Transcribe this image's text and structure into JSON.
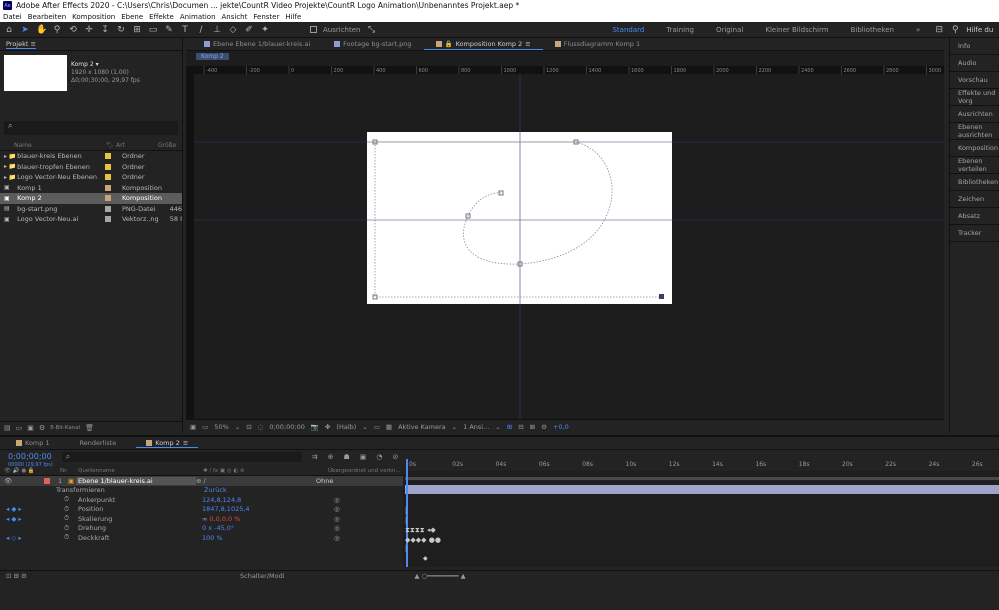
{
  "window": {
    "title": "Adobe After Effects 2020 - C:\\Users\\Chris\\Documen ... jekte\\CountR Video Projekte\\CountR Logo Animation\\Unbenanntes Projekt.aep *",
    "app_badge": "Ae"
  },
  "menu": [
    "Datei",
    "Bearbeiten",
    "Komposition",
    "Ebene",
    "Effekte",
    "Animation",
    "Ansicht",
    "Fenster",
    "Hilfe"
  ],
  "toolbar": {
    "align_label": "Ausrichten",
    "workspaces": [
      "Standard",
      "Training",
      "Original",
      "Kleiner Bildschirm",
      "Bibliotheken"
    ],
    "active_workspace": "Standard",
    "more": "»",
    "search_help": "Hilfe du"
  },
  "project": {
    "tab": "Projekt",
    "preview": {
      "name": "Komp 2 ▾",
      "size": "1920 x 1080 (1,00)",
      "duration": "Δ0;00;30;00, 29,97 fps"
    },
    "search_icon": "⌕",
    "columns": {
      "name": "Name",
      "type": "Art",
      "size": "Größe"
    },
    "items": [
      {
        "name": "blauer-kreis Ebenen",
        "type": "Ordner",
        "size": "",
        "kind": "folder",
        "chip": "#e8c341"
      },
      {
        "name": "blauer-tropfen Ebenen",
        "type": "Ordner",
        "size": "",
        "kind": "folder",
        "chip": "#e8c341"
      },
      {
        "name": "Logo Vector-Neu Ebenen",
        "type": "Ordner",
        "size": "",
        "kind": "folder",
        "chip": "#e8c341"
      },
      {
        "name": "Komp 1",
        "type": "Komposition",
        "size": "",
        "kind": "comp",
        "chip": "#c8a67a"
      },
      {
        "name": "Komp 2",
        "type": "Komposition",
        "size": "",
        "kind": "comp",
        "chip": "#c8a67a"
      },
      {
        "name": "bg-start.png",
        "type": "PNG-Datei",
        "size": "446",
        "kind": "png",
        "chip": "#a6a6a6"
      },
      {
        "name": "Logo Vector-Neu.ai",
        "type": "Vektorz..ng",
        "size": "58 I",
        "kind": "ai",
        "chip": "#a6a6a6"
      }
    ],
    "bit_depth": "8-Bit-Kanal"
  },
  "viewer": {
    "tabs": [
      {
        "label": "Ebene Ebene 1/blauer-kreis.ai",
        "chip": "#8f9bd6"
      },
      {
        "label": "Footage bg-start.png",
        "chip": "#8f9bd6"
      },
      {
        "label": "Komposition Komp 2",
        "chip": "#c8a67a",
        "active": true
      },
      {
        "label": "Flussdiagramm Komp 1",
        "chip": "#c8a67a"
      }
    ],
    "comp_chip": "Komp 2",
    "ruler_labels": [
      "-400",
      "-200",
      "0",
      "200",
      "400",
      "600",
      "800",
      "1000",
      "1200",
      "1400",
      "1600",
      "1800",
      "2000",
      "2200",
      "2400",
      "2600",
      "2800",
      "3000"
    ],
    "footer": {
      "zoom": "50%",
      "time": "0;00;00;00",
      "resolution": "(Halb)",
      "camera": "Aktive Kamera",
      "views": "1 Ansi...",
      "exposure": "+0,0"
    }
  },
  "right_panel": [
    "Info",
    "Audio",
    "Vorschau",
    "Effekte und Vorg",
    "Ausrichten",
    "Ebenen ausrichten",
    "Komposition",
    "Ebenen verteilen",
    "Bibliotheken",
    "Zeichen",
    "Absatz",
    "Tracker"
  ],
  "timeline": {
    "tabs": [
      {
        "label": "Komp 1",
        "chip": "#c8a67a"
      },
      {
        "label": "Renderliste",
        "chip": ""
      },
      {
        "label": "Komp 2",
        "chip": "#c8a67a",
        "active": true
      }
    ],
    "current_time": "0;00;00;00",
    "fps": "00000 (29,97 fps)",
    "col_nr": "Nr.",
    "col_source": "Quellenname",
    "col_parent": "Übergeordnet und verkn...",
    "ticks": [
      "0s",
      "02s",
      "04s",
      "06s",
      "08s",
      "10s",
      "12s",
      "14s",
      "16s",
      "18s",
      "20s",
      "22s",
      "24s",
      "26s"
    ],
    "layer": {
      "index": "1",
      "name": "Ebene 1/blauer-kreis.ai",
      "parent": "Ohne"
    },
    "transform_label": "Transformieren",
    "reset_label": "Zurück",
    "properties": [
      {
        "name": "Ankerpunkt",
        "value": "124,8,124,8"
      },
      {
        "name": "Position",
        "value": "1847,8,1025,4"
      },
      {
        "name": "Skalierung",
        "value_prefix": "∞",
        "value": "0,0,0,0 %"
      },
      {
        "name": "Drehung",
        "value": "0 x -45,0°"
      },
      {
        "name": "Deckkraft",
        "value": "100 %"
      }
    ],
    "footer_label": "Schalter/Modi"
  },
  "colors": {
    "accent": "#4a8af4",
    "panel": "#232323",
    "viewer": "#1d1d1d",
    "layer_bar": "#9ea3c9"
  }
}
